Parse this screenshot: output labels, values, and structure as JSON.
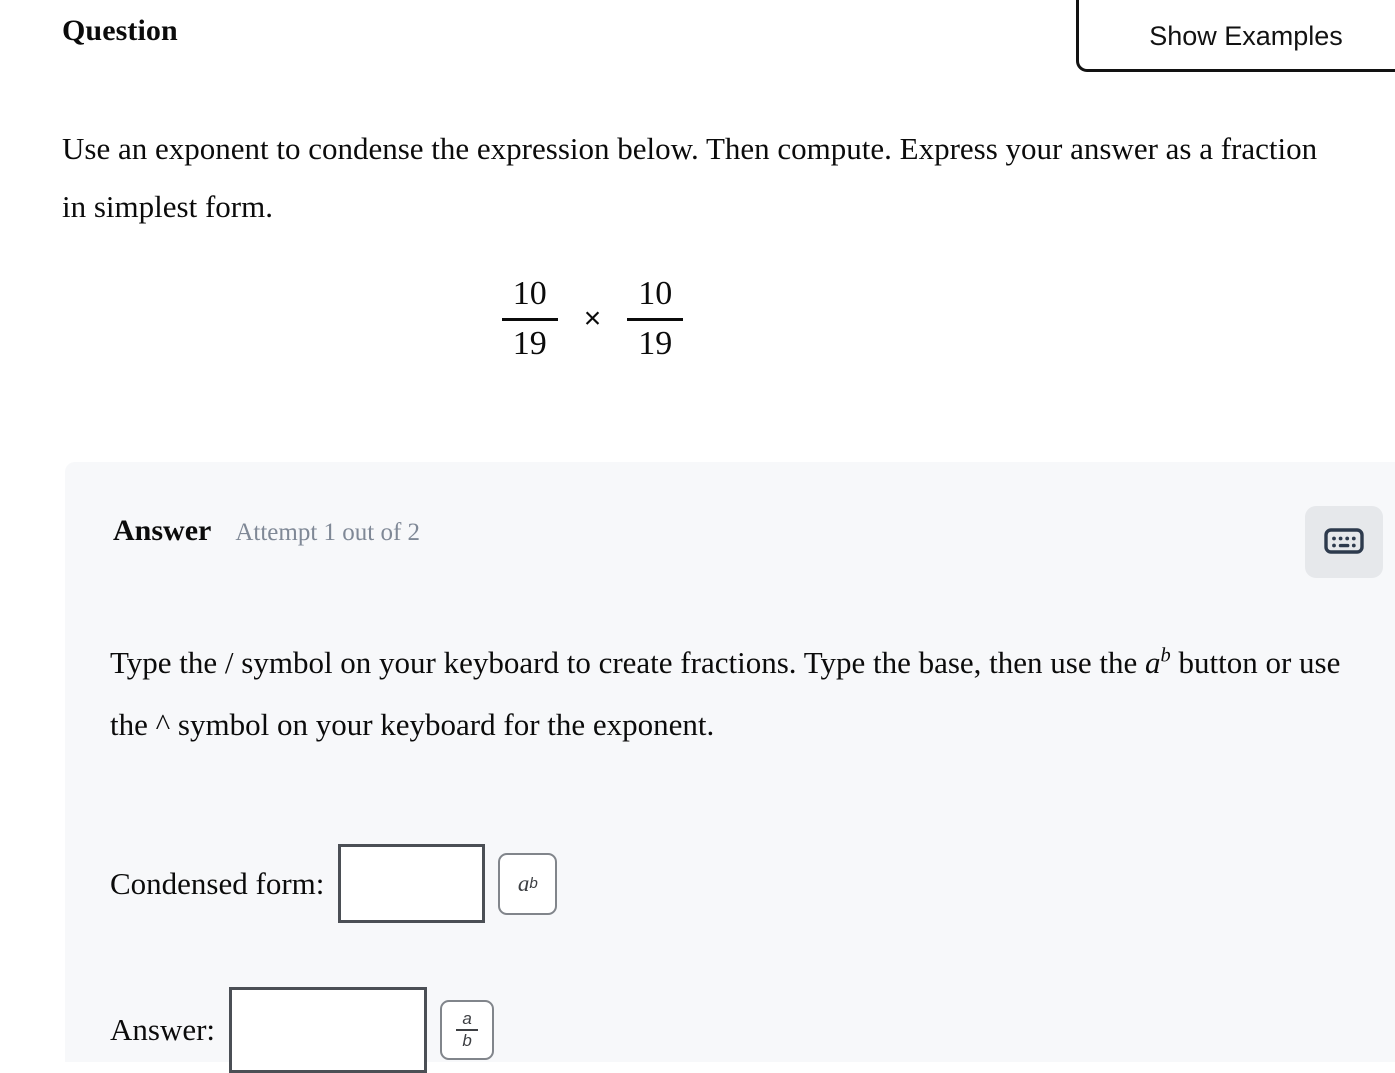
{
  "header": {
    "title": "Question",
    "show_examples_label": "Show Examples"
  },
  "question": {
    "prompt": "Use an exponent to condense the expression below. Then compute. Express your answer as a fraction in simplest form.",
    "expression": {
      "left_fraction": {
        "numerator": "10",
        "denominator": "19"
      },
      "operator": "×",
      "right_fraction": {
        "numerator": "10",
        "denominator": "19"
      }
    }
  },
  "answer_panel": {
    "label": "Answer",
    "attempt": "Attempt 1 out of 2",
    "keyboard_icon": "keyboard-icon",
    "instructions_part1": "Type the / symbol on your keyboard to create fractions. Type the base, then use the ",
    "instructions_var": "a",
    "instructions_sup": "b",
    "instructions_part2": " button or use the ^ symbol on your keyboard for the exponent.",
    "fields": {
      "condensed": {
        "label": "Condensed form:",
        "value": "",
        "placeholder": "",
        "button_base": "a",
        "button_exponent": "b",
        "button_name": "exponent-button"
      },
      "answer": {
        "label": "Answer:",
        "value": "",
        "placeholder": "",
        "button_numerator": "a",
        "button_denominator": "b",
        "button_name": "fraction-button"
      }
    }
  },
  "colors": {
    "panel_background": "#f7f8fa",
    "page_background": "#ffffff",
    "text": "#0b0b0b",
    "muted_text": "#7f8896",
    "input_border": "#4b4f55",
    "tool_border": "#81858b",
    "keyboard_button_bg": "#e6e8eb",
    "keyboard_icon": "#2d3a4d",
    "examples_border": "#121212"
  }
}
